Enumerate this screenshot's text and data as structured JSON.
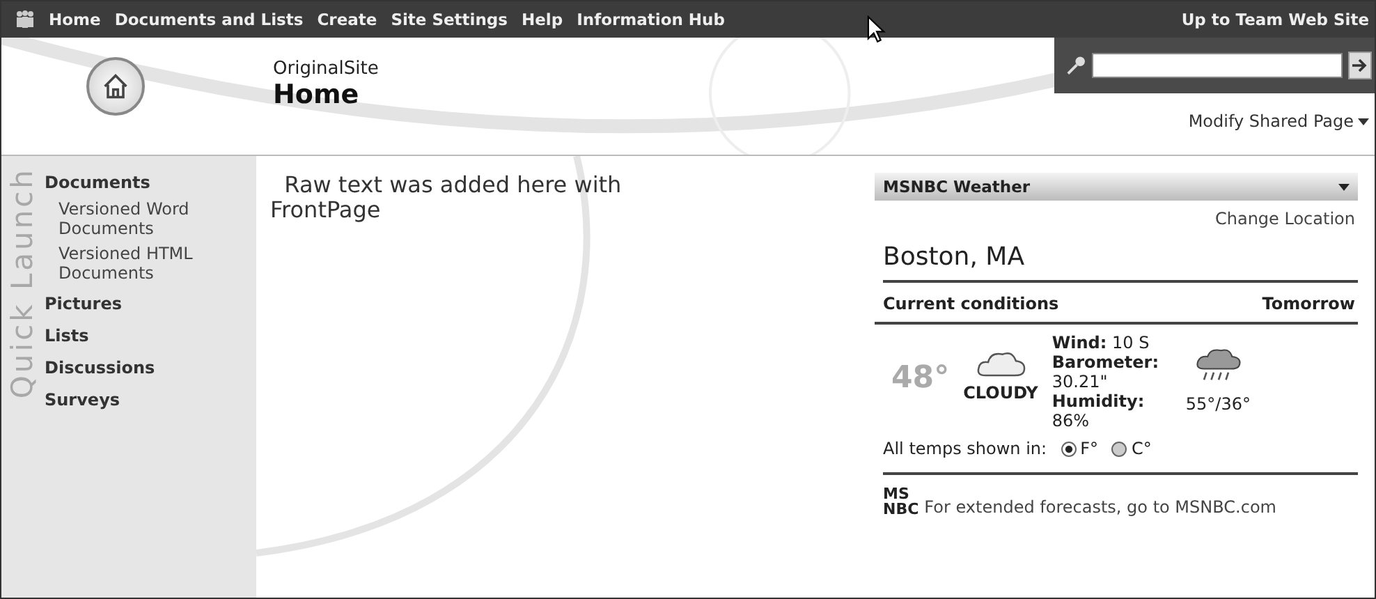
{
  "top_nav": {
    "items": [
      "Home",
      "Documents and Lists",
      "Create",
      "Site Settings",
      "Help",
      "Information Hub"
    ],
    "right_link": "Up to Team Web Site"
  },
  "header": {
    "site_name": "OriginalSite",
    "page_title": "Home",
    "modify_link": "Modify Shared Page"
  },
  "sidebar": {
    "title": "Quick Launch",
    "items": [
      {
        "label": "Documents",
        "children": [
          {
            "label": "Versioned Word Documents"
          },
          {
            "label": "Versioned HTML Documents"
          }
        ]
      },
      {
        "label": "Pictures"
      },
      {
        "label": "Lists"
      },
      {
        "label": "Discussions"
      },
      {
        "label": "Surveys"
      }
    ]
  },
  "content": {
    "text": "  Raw text was added here with FrontPage"
  },
  "weather": {
    "title": "MSNBC Weather",
    "change_location": "Change Location",
    "city": "Boston, MA",
    "current_label": "Current conditions",
    "tomorrow_label": "Tomorrow",
    "temperature": "48°",
    "condition": "CLOUDY",
    "details": [
      {
        "label": "Wind:",
        "value": "10 S"
      },
      {
        "label": "Barometer:",
        "value": "30.21\""
      },
      {
        "label": "Humidity:",
        "value": "86%"
      }
    ],
    "tomorrow_temps": "55°/36°",
    "units_label": "All temps shown in:",
    "units": [
      {
        "label": "F°",
        "selected": true
      },
      {
        "label": "C°",
        "selected": false
      }
    ],
    "logo_lines": [
      "MS",
      "NBC"
    ],
    "footer": "For extended forecasts, go to MSNBC.com"
  }
}
